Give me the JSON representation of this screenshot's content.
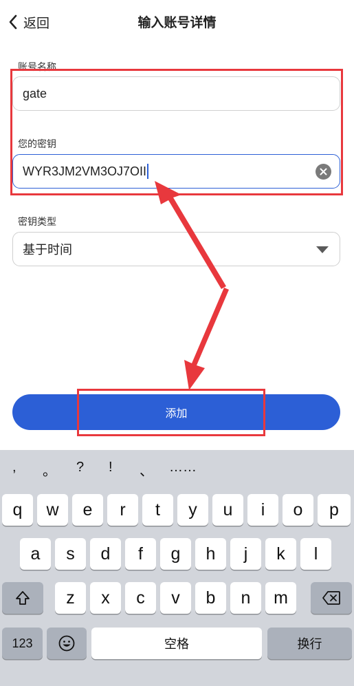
{
  "header": {
    "back_label": "返回",
    "title": "输入账号详情"
  },
  "form": {
    "account_name": {
      "label": "账号名称",
      "value": "gate"
    },
    "secret_key": {
      "label": "您的密钥",
      "value": "WYR3JM2VM3OJ7OII"
    },
    "key_type": {
      "label": "密钥类型",
      "value": "基于时间"
    },
    "add_button": "添加"
  },
  "keyboard": {
    "punctuation": [
      ",",
      "。",
      "?",
      "!",
      "、",
      "……"
    ],
    "row1": [
      "q",
      "w",
      "e",
      "r",
      "t",
      "y",
      "u",
      "i",
      "o",
      "p"
    ],
    "row2": [
      "a",
      "s",
      "d",
      "f",
      "g",
      "h",
      "j",
      "k",
      "l"
    ],
    "row3": [
      "z",
      "x",
      "c",
      "v",
      "b",
      "n",
      "m"
    ],
    "numbers_key": "123",
    "space_key": "空格",
    "return_key": "换行"
  },
  "icons": [
    "chevron-left-icon",
    "clear-icon",
    "dropdown-arrow-icon",
    "shift-icon",
    "backspace-icon",
    "emoji-icon"
  ],
  "colors": {
    "accent": "#2c5fd6",
    "annotation": "#e8383d",
    "keyboard_bg": "#d2d5db"
  }
}
